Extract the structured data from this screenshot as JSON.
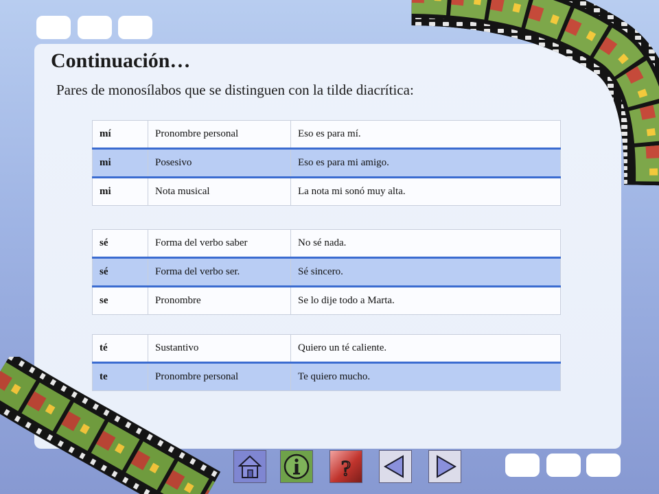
{
  "slide": {
    "title": "Continuación…",
    "subtitle": "Pares de monosílabos que se distinguen con la tilde diacrítica:"
  },
  "tables": [
    {
      "rows": [
        {
          "word": "mí",
          "meaning": "Pronombre personal",
          "example": "Eso es para mí."
        },
        {
          "word": "mi",
          "meaning": "Posesivo",
          "example": "Eso es para mi amigo."
        },
        {
          "word": "mi",
          "meaning": "Nota musical",
          "example": "La nota mi sonó muy alta."
        }
      ]
    },
    {
      "rows": [
        {
          "word": "sé",
          "meaning": "Forma del verbo saber",
          "example": "No sé nada."
        },
        {
          "word": "sé",
          "meaning": "Forma del verbo ser.",
          "example": "Sé sincero."
        },
        {
          "word": "se",
          "meaning": "Pronombre",
          "example": "Se lo dije todo a Marta."
        }
      ]
    },
    {
      "rows": [
        {
          "word": "té",
          "meaning": "Sustantivo",
          "example": "Quiero un té caliente."
        },
        {
          "word": "te",
          "meaning": "Pronombre personal",
          "example": "Te quiero mucho."
        }
      ]
    }
  ],
  "navigation": [
    {
      "name": "home-icon"
    },
    {
      "name": "info-icon"
    },
    {
      "name": "help-icon"
    },
    {
      "name": "previous-arrow-icon"
    },
    {
      "name": "next-arrow-icon"
    }
  ],
  "colors": {
    "background": "#9fb4e4",
    "panel": "#eaf0fa",
    "row_highlight": "#b9cdf4",
    "row_separator": "#3a6bd0",
    "nav_button": "#7f86d2"
  }
}
